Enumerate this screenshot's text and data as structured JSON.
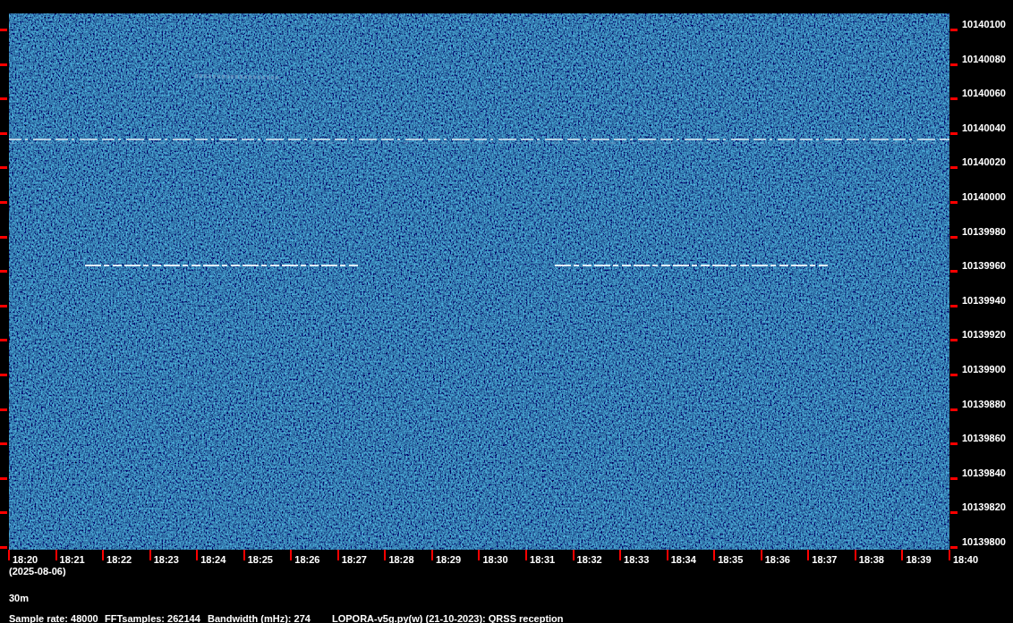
{
  "frequency_axis": {
    "labels": [
      "10140100",
      "10140080",
      "10140060",
      "10140040",
      "10140020",
      "10140000",
      "10139980",
      "10139960",
      "10139940",
      "10139920",
      "10139900",
      "10139880",
      "10139860",
      "10139840",
      "10139820",
      "10139800"
    ]
  },
  "time_axis": {
    "labels": [
      "18:20",
      "18:21",
      "18:22",
      "18:23",
      "18:24",
      "18:25",
      "18:26",
      "18:27",
      "18:28",
      "18:29",
      "18:30",
      "18:31",
      "18:32",
      "18:33",
      "18:34",
      "18:35",
      "18:36",
      "18:37",
      "18:38",
      "18:39",
      "18:40"
    ],
    "date": "(2025-08-06)"
  },
  "band": "30m",
  "status": [
    "Sample rate: 48000",
    "FFTsamples: 262144",
    "Bandwidth (mHz): 274",
    "LOPORA-v5g.py(w) (21-10-2023): QRSS reception"
  ]
}
